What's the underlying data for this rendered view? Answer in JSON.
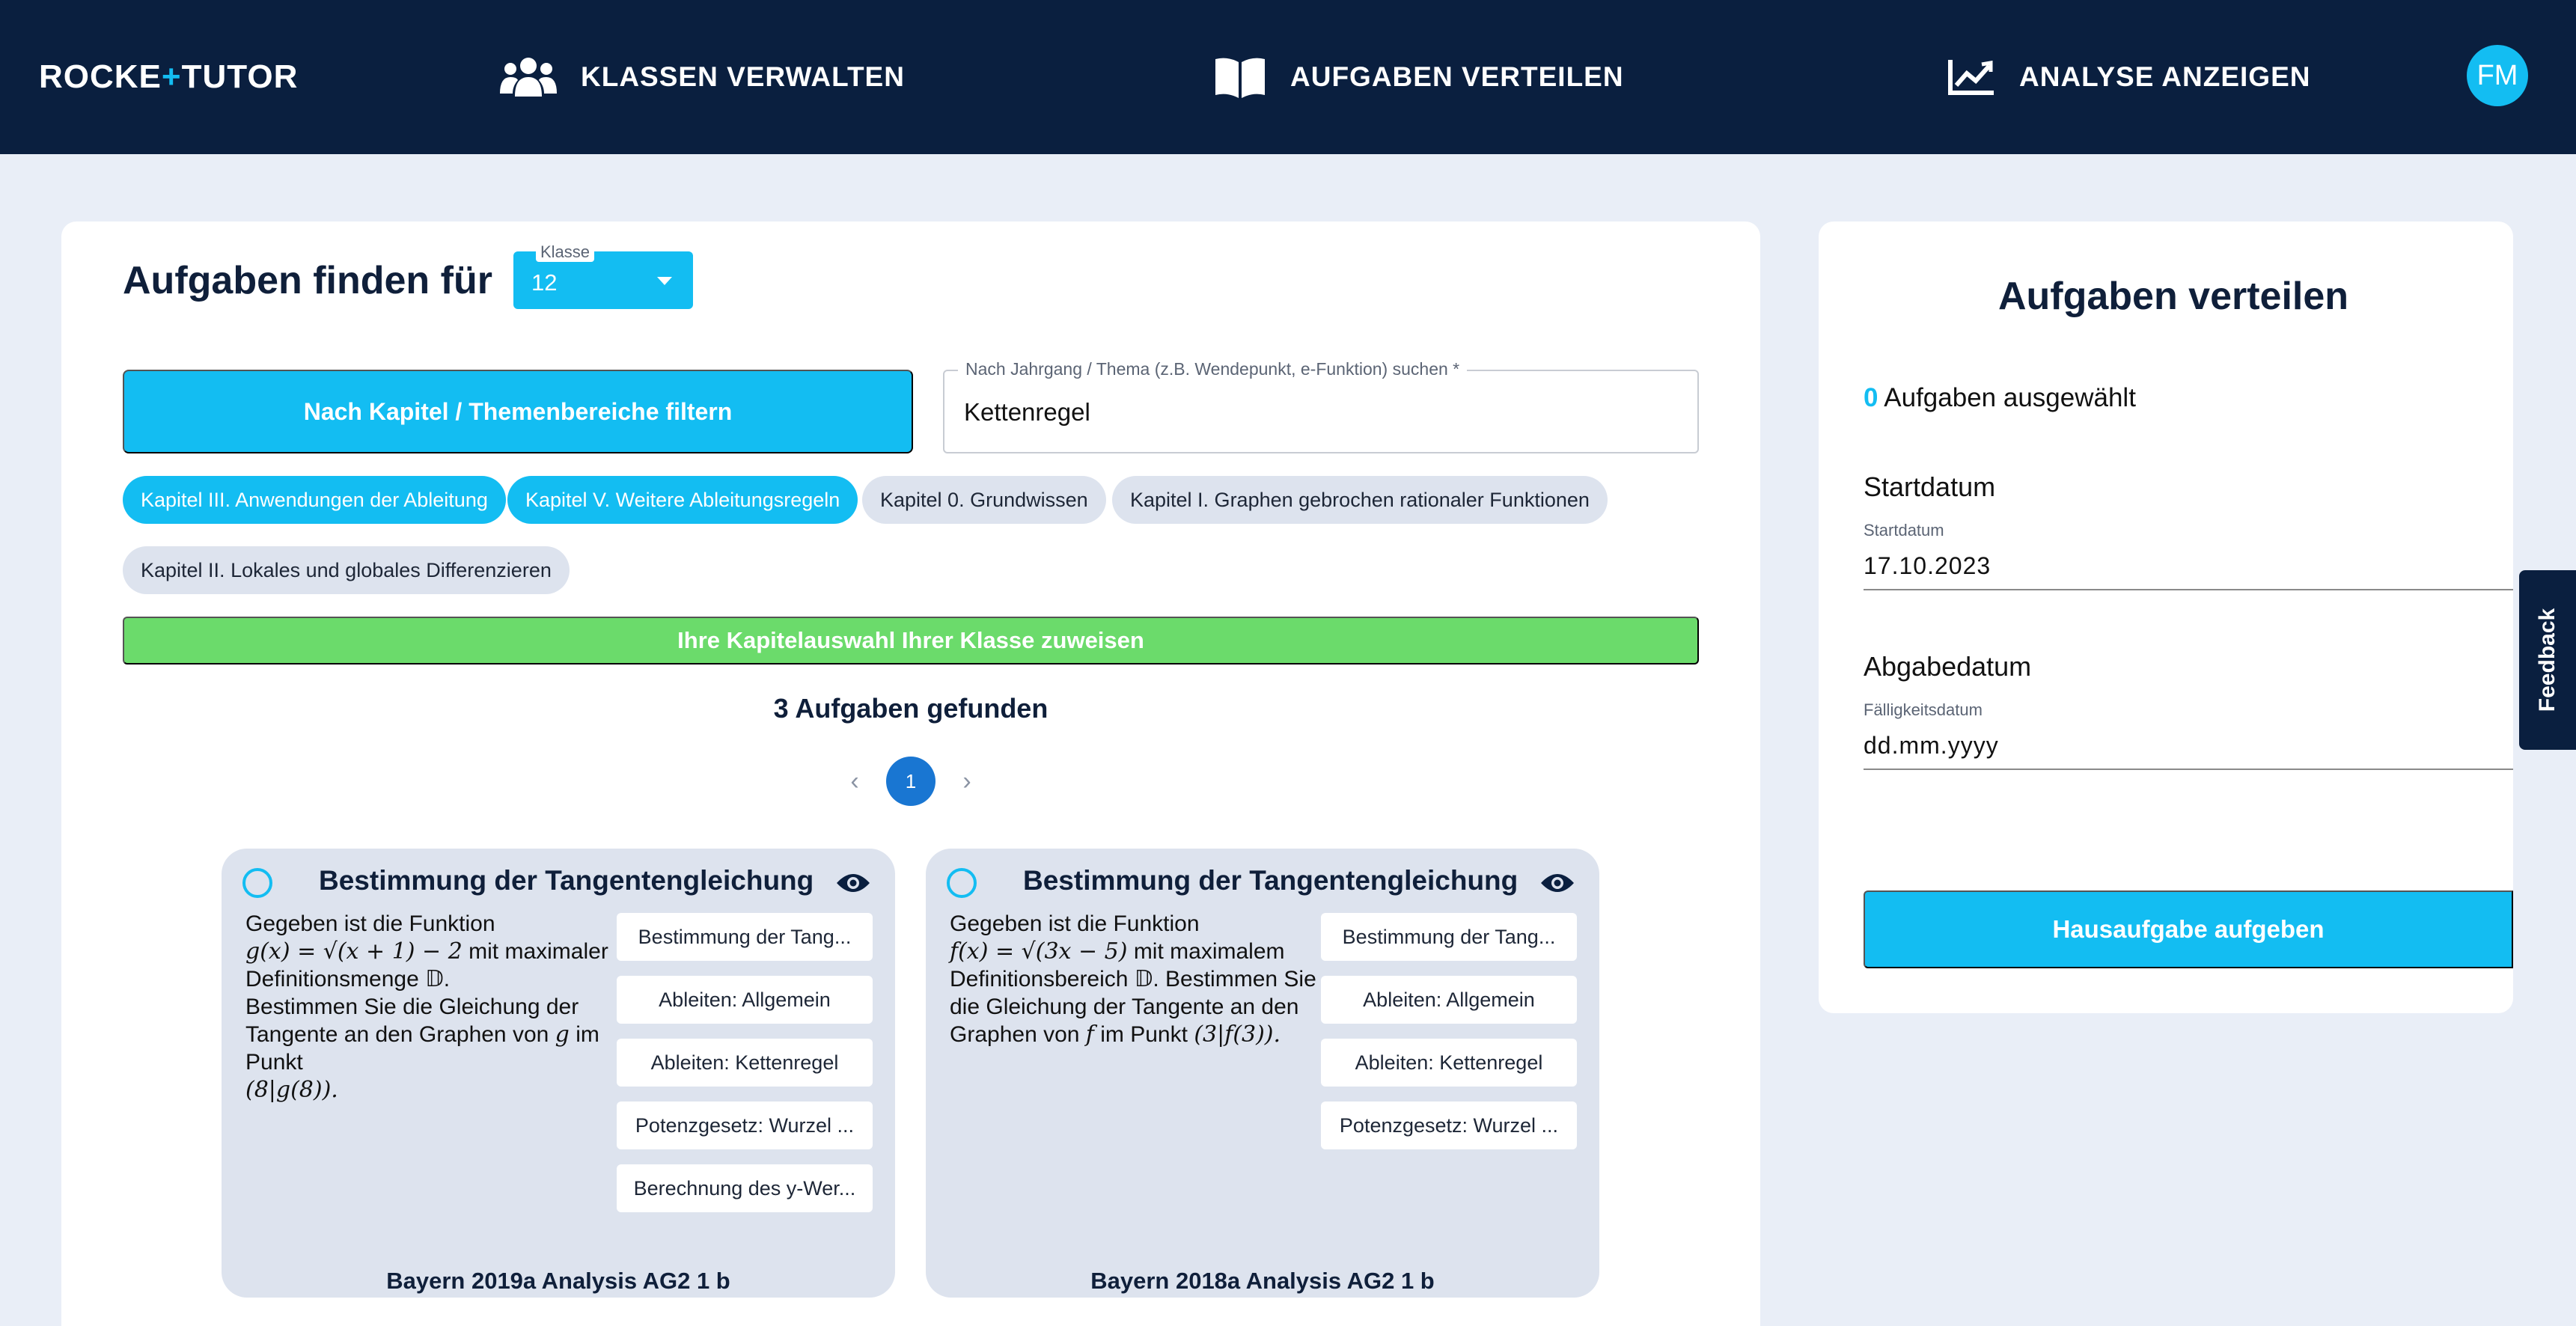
{
  "nav": {
    "logo_left": "ROCKE",
    "logo_plus": "+",
    "logo_mid": "TUTO",
    "logo_end": "R",
    "items": [
      {
        "label": "KLASSEN VERWALTEN",
        "icon": "users-icon"
      },
      {
        "label": "AUFGABEN VERTEILEN",
        "icon": "book-icon"
      },
      {
        "label": "ANALYSE ANZEIGEN",
        "icon": "chart-line-icon"
      }
    ],
    "avatar": "FM"
  },
  "finder": {
    "title": "Aufgaben finden für",
    "class_label": "Klasse",
    "class_value": "12",
    "filter_button": "Nach Kapitel / Themenbereiche filtern",
    "search_label": "Nach Jahrgang / Thema (z.B. Wendepunkt, e-Funktion) suchen *",
    "search_value": "Kettenregel",
    "chips": [
      {
        "label": "Kapitel III. Anwendungen der Ableitung",
        "active": true
      },
      {
        "label": "Kapitel V. Weitere Ableitungsregeln",
        "active": true
      },
      {
        "label": "Kapitel 0. Grundwissen",
        "active": false
      },
      {
        "label": "Kapitel I. Graphen gebrochen rationaler Funktionen",
        "active": false
      },
      {
        "label": "Kapitel II. Lokales und globales Differenzieren",
        "active": false
      }
    ],
    "assign_button": "Ihre Kapitelauswahl Ihrer Klasse zuweisen",
    "found_text": "3 Aufgaben gefunden",
    "pager": {
      "prev": "‹",
      "page": "1",
      "next": "›"
    }
  },
  "tasks": [
    {
      "title": "Bestimmung der Tangentengleichung",
      "desc_1": "Gegeben ist die Funktion",
      "formula": "g(x) = √(x + 1) − 2",
      "desc_2": "mit maximaler Definitionsmenge 𝔻.",
      "desc_3": "Bestimmen Sie die Gleichung der Tangente an den Graphen von",
      "var": "g",
      "desc_4": "im Punkt",
      "point": "(8|g(8)).",
      "tags": [
        "Bestimmung der Tang...",
        "Ableiten: Allgemein",
        "Ableiten: Kettenregel",
        "Potenzgesetz: Wurzel ...",
        "Berechnung des y-Wer..."
      ],
      "source": "Bayern 2019a Analysis AG2 1 b"
    },
    {
      "title": "Bestimmung der Tangentengleichung",
      "desc_1": "Gegeben ist die Funktion",
      "formula": "f(x) = √(3x − 5)",
      "desc_2": "mit maximalem Definitionsbereich 𝔻. Bestimmen Sie die Gleichung der Tangente an den Graphen von",
      "var": "f",
      "desc_4": "im Punkt",
      "point": "(3|f(3)).",
      "tags": [
        "Bestimmung der Tang...",
        "Ableiten: Allgemein",
        "Ableiten: Kettenregel",
        "Potenzgesetz: Wurzel ..."
      ],
      "source": "Bayern 2018a Analysis AG2 1 b"
    }
  ],
  "distribute": {
    "title": "Aufgaben verteilen",
    "selected_count": "0",
    "selected_text": "Aufgaben ausgewählt",
    "start_heading": "Startdatum",
    "start_label": "Startdatum",
    "start_value": "17.10.2023",
    "due_heading": "Abgabedatum",
    "due_label": "Fälligkeitsdatum",
    "due_value": "dd.mm.yyyy",
    "submit_button": "Hausaufgabe aufgeben"
  },
  "feedback_tab": "Feedback",
  "colors": {
    "navy": "#0a1f3f",
    "accent": "#13bdf2",
    "green": "#6bdb6b",
    "page_bg": "#e9eef7",
    "card_bg": "#dde3ee",
    "pager_active": "#1976d2"
  }
}
